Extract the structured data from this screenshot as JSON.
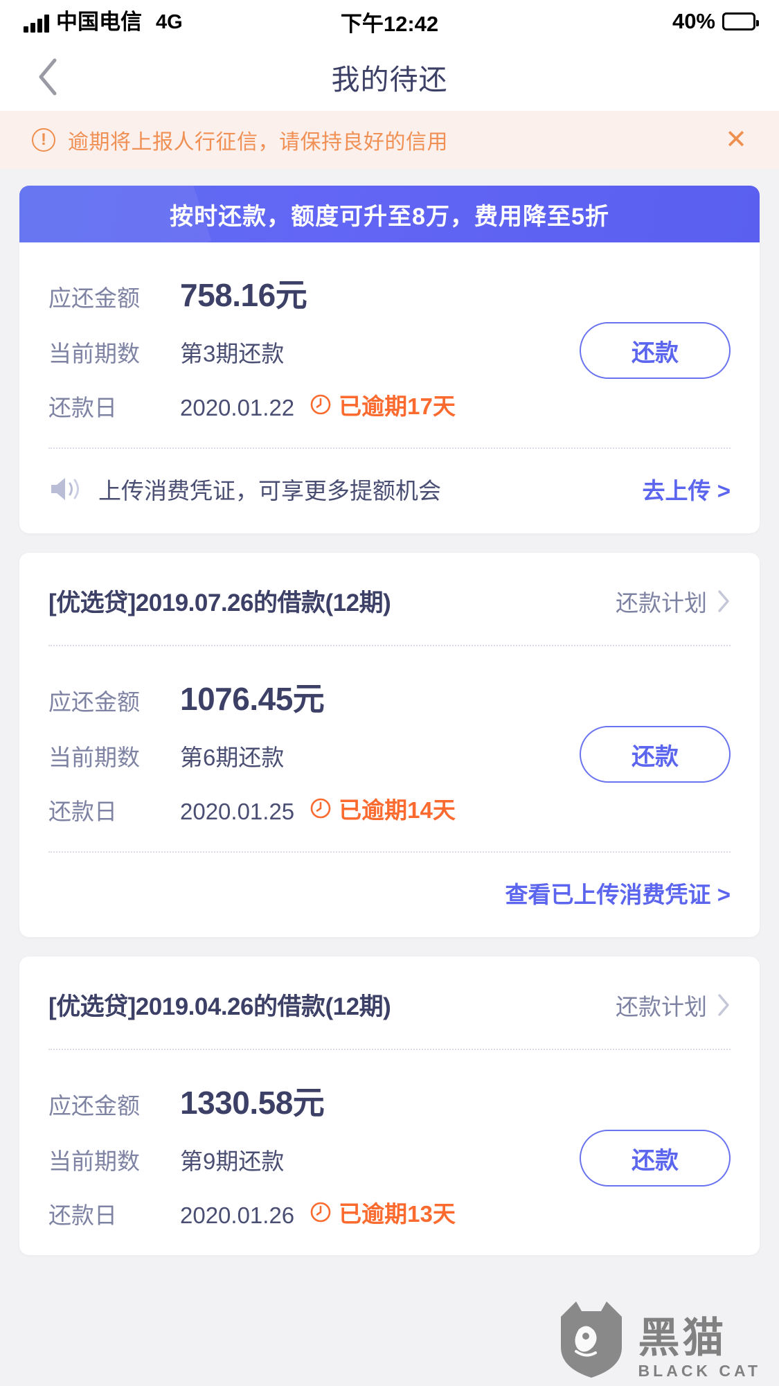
{
  "status_bar": {
    "carrier": "中国电信",
    "network": "4G",
    "time": "下午12:42",
    "battery_percent": "40%"
  },
  "nav": {
    "back_icon": "chevron-left-icon",
    "title": "我的待还"
  },
  "warning_banner": {
    "icon": "exclamation-circle-icon",
    "text": "逾期将上报人行征信，请保持良好的信用",
    "close_icon": "close-icon",
    "bg_color": "#fbf0ec",
    "text_color": "#f09055"
  },
  "promo": {
    "text": "按时还款，额度可升至8万，费用降至5折",
    "bg_color": "#5c6df0"
  },
  "labels": {
    "amount_due": "应还金额",
    "current_period": "当前期数",
    "repay_date": "还款日",
    "repay_button": "还款",
    "repay_plan": "还款计划"
  },
  "cards": [
    {
      "has_title": false,
      "amount": "758.16元",
      "period": "第3期还款",
      "date": "2020.01.22",
      "overdue": "已逾期17天",
      "footer_icon": "speaker-icon",
      "footer_text": "上传消费凭证，可享更多提额机会",
      "footer_link": "去上传 >"
    },
    {
      "has_title": true,
      "title": "[优选贷]2019.07.26的借款(12期)",
      "amount": "1076.45元",
      "period": "第6期还款",
      "date": "2020.01.25",
      "overdue": "已逾期14天",
      "footer_link": "查看已上传消费凭证 >"
    },
    {
      "has_title": true,
      "title": "[优选贷]2019.04.26的借款(12期)",
      "amount": "1330.58元",
      "period": "第9期还款",
      "date": "2020.01.26",
      "overdue": "已逾期13天"
    }
  ],
  "watermark": {
    "cn": "黑猫",
    "en": "BLACK CAT",
    "icon": "black-cat-logo"
  },
  "colors": {
    "accent_blue": "#5b65ee",
    "overdue_orange": "#fb6a2e",
    "title_navy": "#3d4066",
    "label_gray": "#7f83a3",
    "page_bg": "#f2f2f4"
  }
}
